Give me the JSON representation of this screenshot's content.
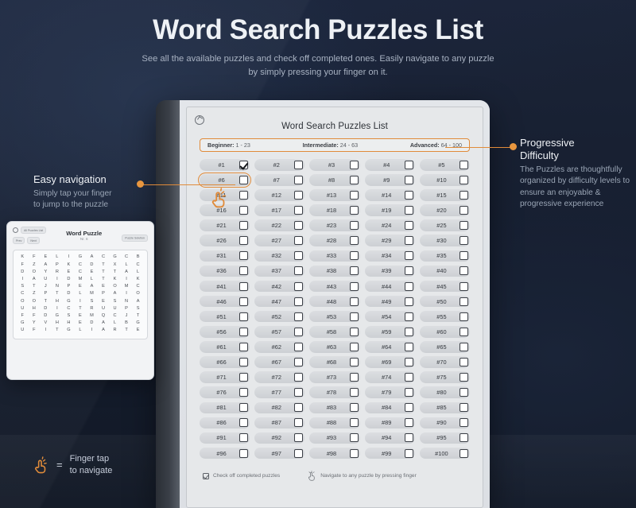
{
  "header": {
    "title": "Word Search Puzzles List",
    "subtitle_line1": "See all the available puzzles and check off completed ones. Easily navigate to any puzzle",
    "subtitle_line2": "by simply pressing your finger on it."
  },
  "device": {
    "home_icon": "home-circle-icon",
    "screen_title": "Word Search Puzzles List",
    "difficulty": [
      {
        "label": "Beginner:",
        "range": "1 - 23"
      },
      {
        "label": "Intermediate:",
        "range": "24 - 63"
      },
      {
        "label": "Advanced:",
        "range": "64 - 100"
      }
    ],
    "puzzles": [
      {
        "label": "#1",
        "checked": true
      },
      {
        "label": "#2",
        "checked": false
      },
      {
        "label": "#3",
        "checked": false
      },
      {
        "label": "#4",
        "checked": false
      },
      {
        "label": "#5",
        "checked": false
      },
      {
        "label": "#6",
        "checked": false,
        "highlight": true
      },
      {
        "label": "#7",
        "checked": false
      },
      {
        "label": "#8",
        "checked": false
      },
      {
        "label": "#9",
        "checked": false
      },
      {
        "label": "#10",
        "checked": false
      },
      {
        "label": "#11",
        "checked": false
      },
      {
        "label": "#12",
        "checked": false
      },
      {
        "label": "#13",
        "checked": false
      },
      {
        "label": "#14",
        "checked": false
      },
      {
        "label": "#15",
        "checked": false
      },
      {
        "label": "#16",
        "checked": false
      },
      {
        "label": "#17",
        "checked": false
      },
      {
        "label": "#18",
        "checked": false
      },
      {
        "label": "#19",
        "checked": false
      },
      {
        "label": "#20",
        "checked": false
      },
      {
        "label": "#21",
        "checked": false
      },
      {
        "label": "#22",
        "checked": false
      },
      {
        "label": "#23",
        "checked": false
      },
      {
        "label": "#24",
        "checked": false
      },
      {
        "label": "#25",
        "checked": false
      },
      {
        "label": "#26",
        "checked": false
      },
      {
        "label": "#27",
        "checked": false
      },
      {
        "label": "#28",
        "checked": false
      },
      {
        "label": "#29",
        "checked": false
      },
      {
        "label": "#30",
        "checked": false
      },
      {
        "label": "#31",
        "checked": false
      },
      {
        "label": "#32",
        "checked": false
      },
      {
        "label": "#33",
        "checked": false
      },
      {
        "label": "#34",
        "checked": false
      },
      {
        "label": "#35",
        "checked": false
      },
      {
        "label": "#36",
        "checked": false
      },
      {
        "label": "#37",
        "checked": false
      },
      {
        "label": "#38",
        "checked": false
      },
      {
        "label": "#39",
        "checked": false
      },
      {
        "label": "#40",
        "checked": false
      },
      {
        "label": "#41",
        "checked": false
      },
      {
        "label": "#42",
        "checked": false
      },
      {
        "label": "#43",
        "checked": false
      },
      {
        "label": "#44",
        "checked": false
      },
      {
        "label": "#45",
        "checked": false
      },
      {
        "label": "#46",
        "checked": false
      },
      {
        "label": "#47",
        "checked": false
      },
      {
        "label": "#48",
        "checked": false
      },
      {
        "label": "#49",
        "checked": false
      },
      {
        "label": "#50",
        "checked": false
      },
      {
        "label": "#51",
        "checked": false
      },
      {
        "label": "#52",
        "checked": false
      },
      {
        "label": "#53",
        "checked": false
      },
      {
        "label": "#54",
        "checked": false
      },
      {
        "label": "#55",
        "checked": false
      },
      {
        "label": "#56",
        "checked": false
      },
      {
        "label": "#57",
        "checked": false
      },
      {
        "label": "#58",
        "checked": false
      },
      {
        "label": "#59",
        "checked": false
      },
      {
        "label": "#60",
        "checked": false
      },
      {
        "label": "#61",
        "checked": false
      },
      {
        "label": "#62",
        "checked": false
      },
      {
        "label": "#63",
        "checked": false
      },
      {
        "label": "#64",
        "checked": false
      },
      {
        "label": "#65",
        "checked": false
      },
      {
        "label": "#66",
        "checked": false
      },
      {
        "label": "#67",
        "checked": false
      },
      {
        "label": "#68",
        "checked": false
      },
      {
        "label": "#69",
        "checked": false
      },
      {
        "label": "#70",
        "checked": false
      },
      {
        "label": "#71",
        "checked": false
      },
      {
        "label": "#72",
        "checked": false
      },
      {
        "label": "#73",
        "checked": false
      },
      {
        "label": "#74",
        "checked": false
      },
      {
        "label": "#75",
        "checked": false
      },
      {
        "label": "#76",
        "checked": false
      },
      {
        "label": "#77",
        "checked": false
      },
      {
        "label": "#78",
        "checked": false
      },
      {
        "label": "#79",
        "checked": false
      },
      {
        "label": "#80",
        "checked": false
      },
      {
        "label": "#81",
        "checked": false
      },
      {
        "label": "#82",
        "checked": false
      },
      {
        "label": "#83",
        "checked": false
      },
      {
        "label": "#84",
        "checked": false
      },
      {
        "label": "#85",
        "checked": false
      },
      {
        "label": "#86",
        "checked": false
      },
      {
        "label": "#87",
        "checked": false
      },
      {
        "label": "#88",
        "checked": false
      },
      {
        "label": "#89",
        "checked": false
      },
      {
        "label": "#90",
        "checked": false
      },
      {
        "label": "#91",
        "checked": false
      },
      {
        "label": "#92",
        "checked": false
      },
      {
        "label": "#93",
        "checked": false
      },
      {
        "label": "#94",
        "checked": false
      },
      {
        "label": "#95",
        "checked": false
      },
      {
        "label": "#96",
        "checked": false
      },
      {
        "label": "#97",
        "checked": false
      },
      {
        "label": "#98",
        "checked": false
      },
      {
        "label": "#99",
        "checked": false
      },
      {
        "label": "#100",
        "checked": false
      }
    ],
    "footer": [
      {
        "icon": "checkbox-icon",
        "text": "Check off completed puzzles"
      },
      {
        "icon": "finger-tap-icon",
        "text": "Navigate to any puzzle by pressing finger"
      }
    ]
  },
  "annotations": {
    "left": {
      "title": "Easy navigation",
      "body_line1": "Simply tap your finger",
      "body_line2": "to jump to the puzzle"
    },
    "right": {
      "title_line1": "Progressive",
      "title_line2": "Difficulty",
      "body": "The Puzzles are thoughtfully organized by difficulty levels to ensure an enjoyable & progressive experience"
    }
  },
  "legend": {
    "icon": "finger-tap-icon",
    "equals": "=",
    "line1": "Finger tap",
    "line2": "to navigate"
  },
  "word_puzzle_card": {
    "home_icon": "home-circle-icon",
    "chip_left": "All Puzzles List",
    "chip_right": "Puzzle Solution",
    "chip_prev": "Prev",
    "chip_next": "Next",
    "title": "Word Puzzle",
    "subtitle": "Nr. 6",
    "grid": [
      [
        "K",
        "F",
        "E",
        "L",
        "I",
        "G",
        "A",
        "C",
        "G",
        "C",
        "B"
      ],
      [
        "F",
        "Z",
        "A",
        "P",
        "K",
        "C",
        "D",
        "T",
        "X",
        "L",
        "C"
      ],
      [
        "D",
        "O",
        "Y",
        "R",
        "E",
        "C",
        "E",
        "T",
        "T",
        "A",
        "L"
      ],
      [
        "I",
        "A",
        "U",
        "I",
        "D",
        "M",
        "L",
        "T",
        "K",
        "I",
        "K"
      ],
      [
        "S",
        "T",
        "J",
        "N",
        "P",
        "E",
        "A",
        "E",
        "O",
        "M",
        "C"
      ],
      [
        "C",
        "Z",
        "P",
        "T",
        "D",
        "L",
        "M",
        "P",
        "A",
        "I",
        "O"
      ],
      [
        "O",
        "O",
        "T",
        "H",
        "G",
        "I",
        "S",
        "E",
        "S",
        "N",
        "A"
      ],
      [
        "U",
        "H",
        "D",
        "I",
        "C",
        "T",
        "R",
        "U",
        "U",
        "P",
        "S"
      ],
      [
        "F",
        "F",
        "D",
        "G",
        "S",
        "E",
        "M",
        "Q",
        "C",
        "J",
        "T"
      ],
      [
        "G",
        "Y",
        "V",
        "H",
        "H",
        "E",
        "D",
        "A",
        "L",
        "B",
        "G"
      ],
      [
        "U",
        "F",
        "I",
        "T",
        "G",
        "L",
        "I",
        "A",
        "R",
        "T",
        "E"
      ]
    ]
  },
  "colors": {
    "accent": "#e08b3a",
    "background": "#1b2437",
    "screen": "#e6e8ea"
  }
}
